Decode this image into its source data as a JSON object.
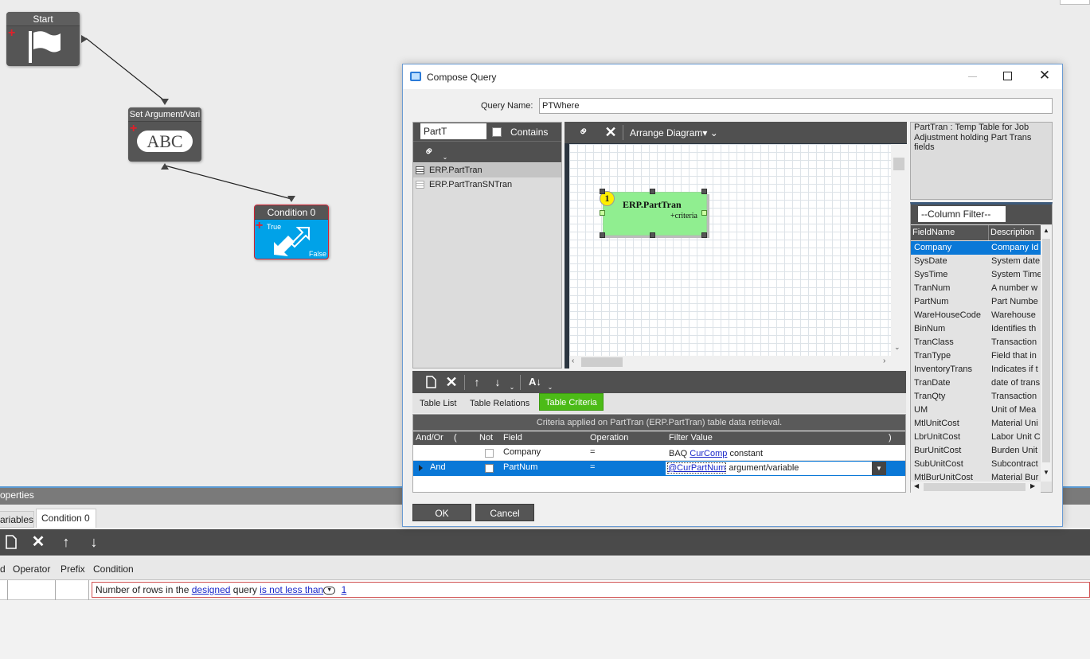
{
  "workflow": {
    "start_title": "Start",
    "setarg_title": "Set Argument/Vari",
    "setarg_glyph": "ABC",
    "condition_title": "Condition 0",
    "condition_true": "True",
    "condition_false": "False"
  },
  "dialog": {
    "title": "Compose Query",
    "query_name_label": "Query Name:",
    "query_name_value": "PTWhere",
    "search_value": "PartT",
    "contains_label": "Contains",
    "tables": [
      "ERP.PartTran",
      "ERP.PartTranSNTran"
    ],
    "arrange_label": "Arrange Diagram",
    "diagram_table": {
      "badge": "1",
      "name": "ERP.PartTran",
      "criteria": "+criteria"
    },
    "description": "PartTran : Temp Table for Job Adjustment holding Part Trans fields",
    "column_filter": "--Column Filter--",
    "field_headers": {
      "name": "FieldName",
      "description": "Description"
    },
    "fields": [
      {
        "name": "Company",
        "desc": "Company Id"
      },
      {
        "name": "SysDate",
        "desc": "System date"
      },
      {
        "name": "SysTime",
        "desc": "System Time"
      },
      {
        "name": "TranNum",
        "desc": "A number w"
      },
      {
        "name": "PartNum",
        "desc": "Part Numbe"
      },
      {
        "name": "WareHouseCode",
        "desc": "Warehouse"
      },
      {
        "name": "BinNum",
        "desc": "Identifies th"
      },
      {
        "name": "TranClass",
        "desc": "Transaction"
      },
      {
        "name": "TranType",
        "desc": "Field that in"
      },
      {
        "name": "InventoryTrans",
        "desc": "Indicates if t"
      },
      {
        "name": "TranDate",
        "desc": "date of trans"
      },
      {
        "name": "TranQty",
        "desc": "Transaction"
      },
      {
        "name": "UM",
        "desc": "Unit of Mea"
      },
      {
        "name": "MtlUnitCost",
        "desc": "Material Uni"
      },
      {
        "name": "LbrUnitCost",
        "desc": "Labor Unit C"
      },
      {
        "name": "BurUnitCost",
        "desc": "Burden Unit"
      },
      {
        "name": "SubUnitCost",
        "desc": "Subcontract"
      },
      {
        "name": "MtlBurUnitCost",
        "desc": "Material Bur"
      }
    ],
    "tabs": [
      "Table List",
      "Table Relations",
      "Table Criteria"
    ],
    "criteria_caption": "Criteria applied on PartTran (ERP.PartTran)  table data retrieval.",
    "criteria_headers": {
      "andor": "And/Or",
      "paren_open": "(",
      "not": "Not",
      "field": "Field",
      "operation": "Operation",
      "filter_value": "Filter Value",
      "paren_close": ")"
    },
    "criteria_rows": [
      {
        "andor": "",
        "field": "Company",
        "operation": "=",
        "prefix": "BAQ",
        "link": "CurComp",
        "suffix": "constant"
      },
      {
        "andor": "And",
        "field": "PartNum",
        "operation": "=",
        "prefix": "",
        "link": "@CurPartNum",
        "suffix": "argument/variable"
      }
    ],
    "ok_label": "OK",
    "cancel_label": "Cancel"
  },
  "bottom": {
    "panel_title": "operties",
    "tab_variables": "ariables",
    "tab_condition": "Condition 0",
    "headers": {
      "d": "d",
      "operator": "Operator",
      "prefix": "Prefix",
      "condition": "Condition"
    },
    "condition": {
      "text1": "Number of rows in the",
      "link1": "designed",
      "text2": "query",
      "link2": "is not less than",
      "link3": "1"
    }
  }
}
